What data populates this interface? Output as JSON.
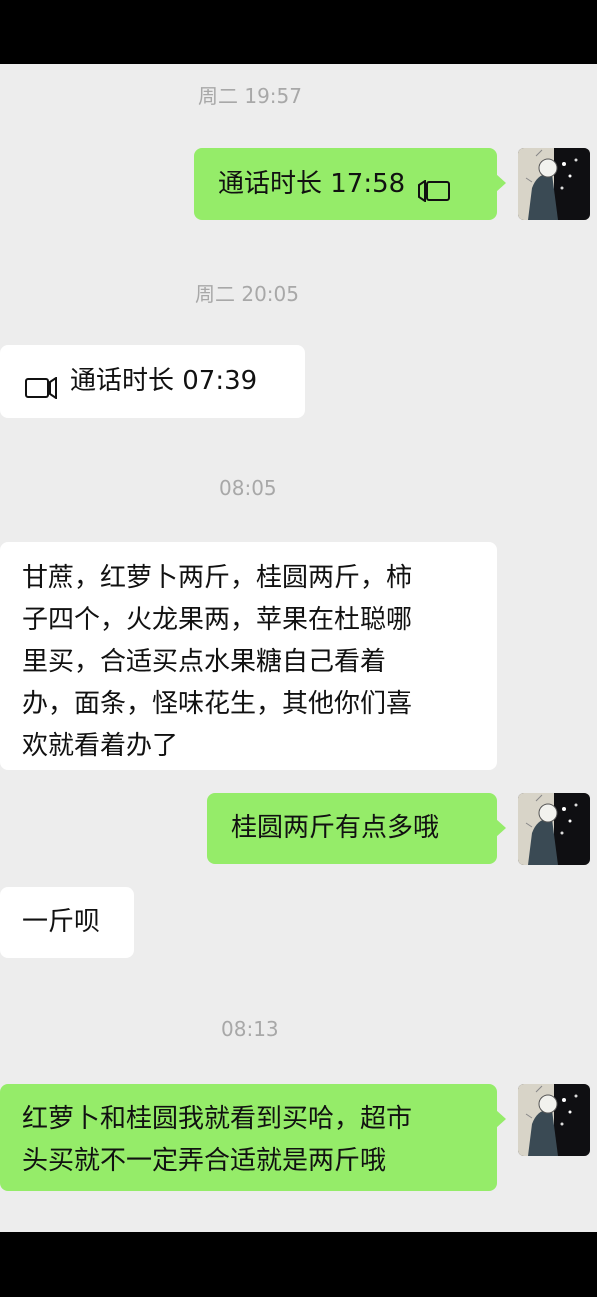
{
  "chat": {
    "messages": [
      {
        "type": "time",
        "text": "周二 19:57"
      },
      {
        "type": "sent_call",
        "text": "通话时长 17:58",
        "icon": "video-camera-icon"
      },
      {
        "type": "time",
        "text": "周二 20:05"
      },
      {
        "type": "recv_call",
        "text": "通话时长 07:39",
        "icon": "video-camera-icon"
      },
      {
        "type": "time",
        "text": "08:05"
      },
      {
        "type": "recv",
        "lines": [
          "甘蔗，红萝卜两斤，桂圆两斤，柿",
          "子四个，火龙果两，苹果在杜聪哪",
          "里买，合适买点水果糖自己看着",
          "办，面条，怪味花生，其他你们喜",
          "欢就看着办了"
        ]
      },
      {
        "type": "sent",
        "text": "桂圆两斤有点多哦"
      },
      {
        "type": "recv",
        "text": "一斤呗"
      },
      {
        "type": "time",
        "text": "08:13"
      },
      {
        "type": "sent",
        "lines": [
          "红萝卜和桂圆我就看到买哈，超市",
          "头买就不一定弄合适就是两斤哦"
        ]
      }
    ]
  },
  "colors": {
    "sent_bubble": "#95ec69",
    "recv_bubble": "#ffffff",
    "background": "#ededed",
    "timestamp": "#a8a8a8"
  }
}
